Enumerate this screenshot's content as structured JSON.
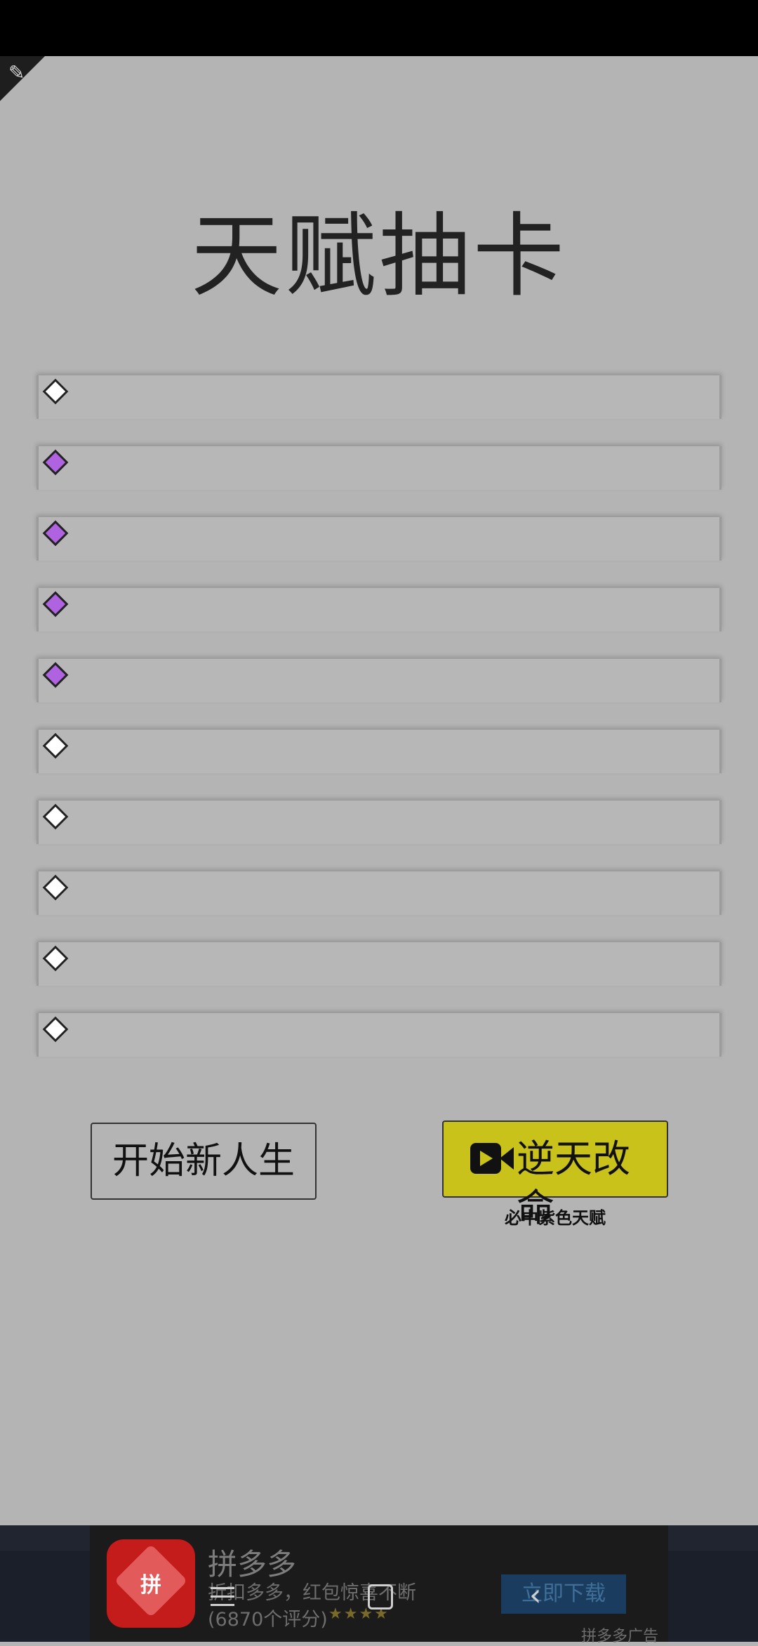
{
  "title": "天赋抽卡",
  "talents": [
    {
      "label": "",
      "rarity": "white"
    },
    {
      "label": "",
      "rarity": "purple"
    },
    {
      "label": "",
      "rarity": "purple"
    },
    {
      "label": "",
      "rarity": "purple"
    },
    {
      "label": "",
      "rarity": "purple"
    },
    {
      "label": "",
      "rarity": "white"
    },
    {
      "label": "",
      "rarity": "white"
    },
    {
      "label": "",
      "rarity": "white"
    },
    {
      "label": "",
      "rarity": "white"
    },
    {
      "label": "",
      "rarity": "white"
    }
  ],
  "buttons": {
    "new_life": "开始新人生",
    "revive": "逆天改命",
    "revive_sub": "必中紫色天赋"
  },
  "ad": {
    "name": "拼多多",
    "description": "折扣多多，红包惊喜不断",
    "rating": "(6870个评分)",
    "stars": "★★★★",
    "cta": "立即下载",
    "tag": "拼多多广告",
    "logo_text": "拼"
  },
  "colors": {
    "purple_talent": "#b063e0",
    "revive_button": "#c9c21b"
  }
}
